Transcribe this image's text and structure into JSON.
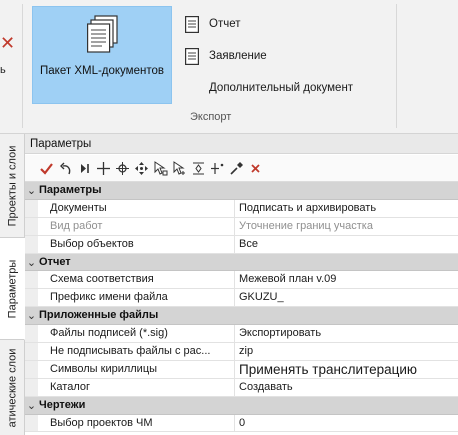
{
  "ribbon": {
    "left_partial_label": "ь",
    "xml_package_label": "Пакет XML-документов",
    "items": [
      {
        "label": "Отчет",
        "icon": "document-icon"
      },
      {
        "label": "Заявление",
        "icon": "document-icon"
      },
      {
        "label": "Дополнительный документ"
      }
    ],
    "group_label": "Экспорт"
  },
  "side_tabs": [
    {
      "label": "Проекты и слои"
    },
    {
      "label": "Параметры"
    },
    {
      "label": "атические слои"
    }
  ],
  "panel": {
    "title": "Параметры"
  },
  "toolbar": {
    "icons": [
      "checkmark-icon",
      "undo-icon",
      "skip-icon",
      "crosshair-icon",
      "target-icon",
      "move-icon",
      "select-cursor-icon",
      "select-point-icon",
      "fit-icon",
      "point-add-icon",
      "eyedropper-icon",
      "close-icon"
    ]
  },
  "grid": {
    "sections": [
      {
        "label": "Параметры",
        "rows": [
          {
            "name": "Документы",
            "value": "Подписать и архивировать"
          },
          {
            "name": "Вид работ",
            "value": "Уточнение границ участка",
            "disabled": true
          },
          {
            "name": "Выбор объектов",
            "value": "Все"
          }
        ]
      },
      {
        "label": "Отчет",
        "rows": [
          {
            "name": "Схема соответствия",
            "value": "Межевой план v.09"
          },
          {
            "name": "Префикс имени файла",
            "value": "GKUZU_"
          }
        ]
      },
      {
        "label": "Приложенные файлы",
        "rows": [
          {
            "name": "Файлы подписей (*.sig)",
            "value": "Экспортировать"
          },
          {
            "name": "Не подписывать файлы с рас...",
            "value": "zip"
          },
          {
            "name": "Символы кириллицы",
            "value": "Применять транслитерацию",
            "big": true
          },
          {
            "name": "Каталог",
            "value": "Создавать"
          }
        ]
      },
      {
        "label": "Чертежи",
        "rows": [
          {
            "name": "Выбор проектов ЧМ",
            "value": "0"
          }
        ]
      }
    ]
  },
  "colors": {
    "accent_button": "#9fd0f5",
    "checkmark": "#c0392b",
    "category_bg": "#d4d4d4"
  }
}
